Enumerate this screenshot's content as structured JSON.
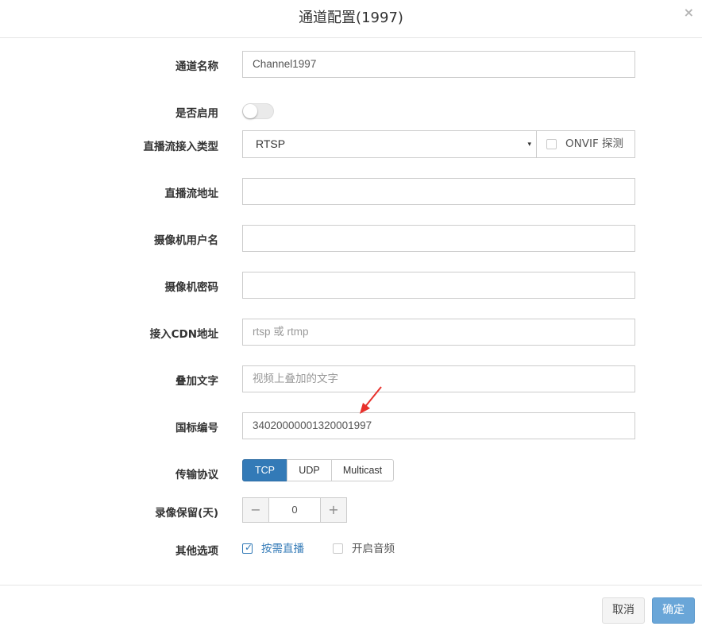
{
  "dialog": {
    "title": "通道配置(1997)",
    "close_icon": "×"
  },
  "form": {
    "channel_name": {
      "label": "通道名称",
      "value": "Channel1997"
    },
    "enabled": {
      "label": "是否启用",
      "on": false
    },
    "stream_type": {
      "label": "直播流接入类型",
      "selected": "RTSP",
      "caret": "▾",
      "onvif_label": "ONVIF 探测",
      "onvif_checked": false
    },
    "stream_url": {
      "label": "直播流地址",
      "value": ""
    },
    "camera_user": {
      "label": "摄像机用户名",
      "value": ""
    },
    "camera_password": {
      "label": "摄像机密码",
      "value": ""
    },
    "cdn_url": {
      "label": "接入CDN地址",
      "placeholder": "rtsp 或 rtmp"
    },
    "overlay_text": {
      "label": "叠加文字",
      "placeholder": "视频上叠加的文字"
    },
    "gb_id": {
      "label": "国标编号",
      "value": "34020000001320001997"
    },
    "protocol": {
      "label": "传输协议",
      "options": [
        "TCP",
        "UDP",
        "Multicast"
      ],
      "selected": "TCP"
    },
    "record_days": {
      "label": "录像保留(天)",
      "value": "0",
      "minus": "−",
      "plus": "+"
    },
    "other_options": {
      "label": "其他选项",
      "on_demand": {
        "label": "按需直播",
        "checked": true,
        "check_mark": "✓"
      },
      "audio": {
        "label": "开启音频",
        "checked": false
      }
    }
  },
  "footer": {
    "cancel_label": "取消",
    "ok_label": "确定"
  },
  "colors": {
    "primary": "#337ab7",
    "ok_button": "#6aa6d8",
    "annotation_arrow": "#e8312c"
  }
}
